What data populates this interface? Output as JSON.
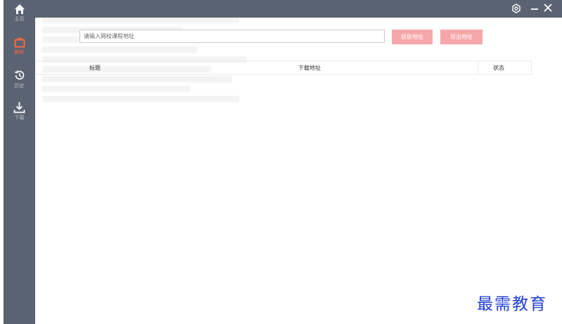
{
  "sidebar": {
    "items": [
      {
        "label": "主页",
        "icon": "home-icon"
      },
      {
        "label": "解析",
        "icon": "tv-icon"
      },
      {
        "label": "历史",
        "icon": "history-icon"
      },
      {
        "label": "下载",
        "icon": "download-icon"
      }
    ],
    "active_index": 1
  },
  "window": {
    "controls": [
      "settings-icon",
      "minimize-icon",
      "close-icon"
    ]
  },
  "search": {
    "placeholder": "请输入网校课程地址",
    "value": ""
  },
  "actions": {
    "fetch_label": "获取地址",
    "export_label": "导出地址"
  },
  "table": {
    "columns": [
      "标题",
      "下载地址",
      "状态"
    ],
    "rows": []
  },
  "watermark": "最需教育",
  "colors": {
    "sidebar": "#5a6371",
    "accent": "#ff6a3d",
    "button": "#f6a7a9",
    "watermark": "#1f3fd8"
  }
}
